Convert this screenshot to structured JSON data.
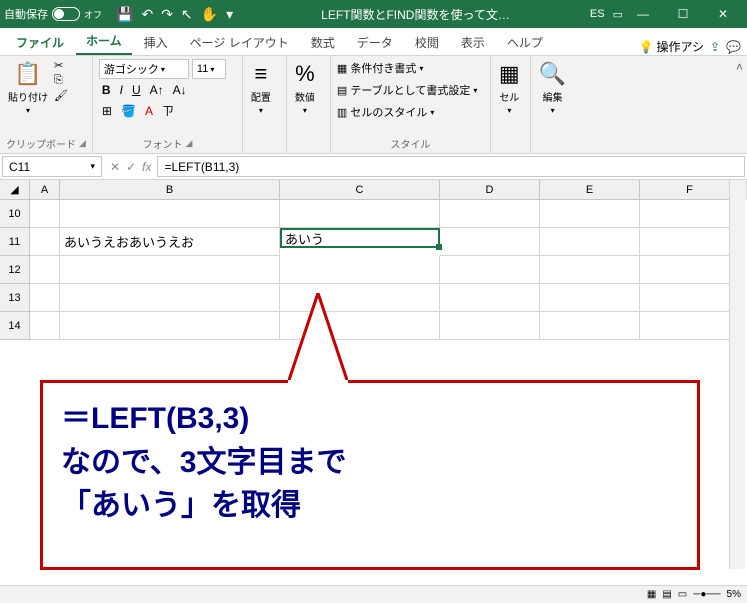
{
  "titlebar": {
    "autosave_label": "自動保存",
    "autosave_state": "オフ",
    "doc_title": "LEFT関数とFIND関数を使って文…",
    "user_initials": "ES"
  },
  "tabs": {
    "file": "ファイル",
    "home": "ホーム",
    "insert": "挿入",
    "pagelayout": "ページ レイアウト",
    "formulas": "数式",
    "data": "データ",
    "review": "校閲",
    "view": "表示",
    "help": "ヘルプ",
    "tell_me": "操作アシ"
  },
  "ribbon": {
    "clipboard": {
      "paste": "貼り付け",
      "group_label": "クリップボード"
    },
    "font": {
      "font_name": "游ゴシック",
      "font_size": "11",
      "group_label": "フォント"
    },
    "alignment": {
      "label": "配置"
    },
    "number": {
      "label": "数値"
    },
    "styles": {
      "conditional": "条件付き書式",
      "table": "テーブルとして書式設定",
      "cell_styles": "セルのスタイル",
      "group_label": "スタイル"
    },
    "cells": {
      "label": "セル"
    },
    "editing": {
      "label": "編集"
    }
  },
  "formula_bar": {
    "name_box": "C11",
    "formula": "=LEFT(B11,3)"
  },
  "grid": {
    "columns": [
      "A",
      "B",
      "C",
      "D",
      "E",
      "F"
    ],
    "rows": [
      "10",
      "11",
      "12",
      "13",
      "14"
    ],
    "b11": "あいうえおあいうえお",
    "c11": "あいう"
  },
  "callout": {
    "line1": "＝LEFT(B3,3)",
    "line2": "なので、3文字目まで",
    "line3": "「あいう」を取得"
  },
  "status": {
    "zoom": "5%"
  }
}
